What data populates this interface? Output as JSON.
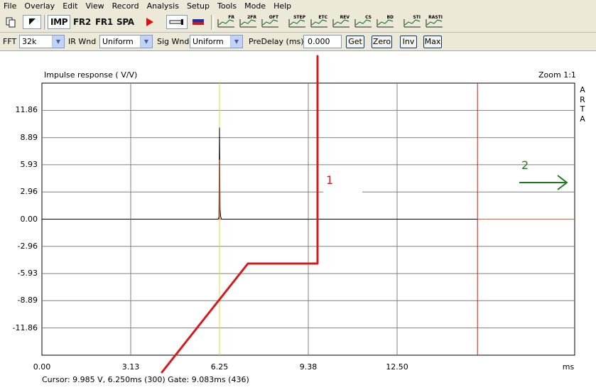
{
  "menu": [
    "File",
    "Overlay",
    "Edit",
    "View",
    "Record",
    "Analysis",
    "Setup",
    "Tools",
    "Mode",
    "Help"
  ],
  "toolbar": {
    "imp": "IMP",
    "fr2": "FR2",
    "fr1": "FR1",
    "spa": "SPA",
    "mini_labels": [
      "FR",
      "2FR",
      "OFT",
      "STEP",
      "ETC",
      "REV",
      "CS",
      "BD",
      "STI",
      "RASTI"
    ]
  },
  "options": {
    "fft_label": "FFT",
    "fft_value": "32k",
    "irwnd_label": "IR Wnd",
    "irwnd_value": "Uniform",
    "sigwnd_label": "Sig Wnd",
    "sigwnd_value": "Uniform",
    "predelay_label": "PreDelay (ms)",
    "predelay_value": "0.000",
    "get": "Get",
    "zero": "Zero",
    "inv": "Inv",
    "max": "Max"
  },
  "plot": {
    "title": "Impulse response ( V/V)",
    "zoom": "Zoom 1:1",
    "brand": [
      "A",
      "R",
      "T",
      "A"
    ],
    "cursor_text": "Cursor: 9.985 V, 6.250ms (300)  Gate: 9.083ms (436)",
    "annotation_1": "1",
    "annotation_2": "2"
  },
  "chart_data": {
    "type": "line",
    "title": "Impulse response ( V/V)",
    "xlabel": "ms",
    "ylabel": "",
    "xlim": [
      0,
      18.75
    ],
    "ylim": [
      -14.83,
      14.83
    ],
    "x_ticks": [
      "0.00",
      "3.13",
      "6.25",
      "9.38",
      "12.50"
    ],
    "x_tick_values": [
      0,
      3.125,
      6.25,
      9.375,
      12.5
    ],
    "y_ticks": [
      "11.86",
      "8.89",
      "5.93",
      "2.96",
      "0.00",
      "-2.96",
      "-5.93",
      "-8.89",
      "-11.86"
    ],
    "y_tick_values": [
      11.86,
      8.89,
      5.93,
      2.96,
      0,
      -2.96,
      -5.93,
      -8.89,
      -11.86
    ],
    "grid": true,
    "cursor_x": 6.25,
    "gate_x": 15.33,
    "series": [
      {
        "color": "#000000",
        "points": [
          [
            0,
            0
          ],
          [
            6.2,
            0
          ],
          [
            6.23,
            0.2
          ],
          [
            6.25,
            9.985
          ],
          [
            6.27,
            1.1
          ],
          [
            6.29,
            0.3
          ],
          [
            6.32,
            0
          ],
          [
            15.33,
            0
          ]
        ]
      }
    ],
    "colors": {
      "zero_line": "#cc6a3a",
      "cursor": "#e8d24a",
      "gate": "#b82020",
      "annotation_red": "#d41a1a",
      "annotation_green": "#1e7a1e"
    }
  }
}
